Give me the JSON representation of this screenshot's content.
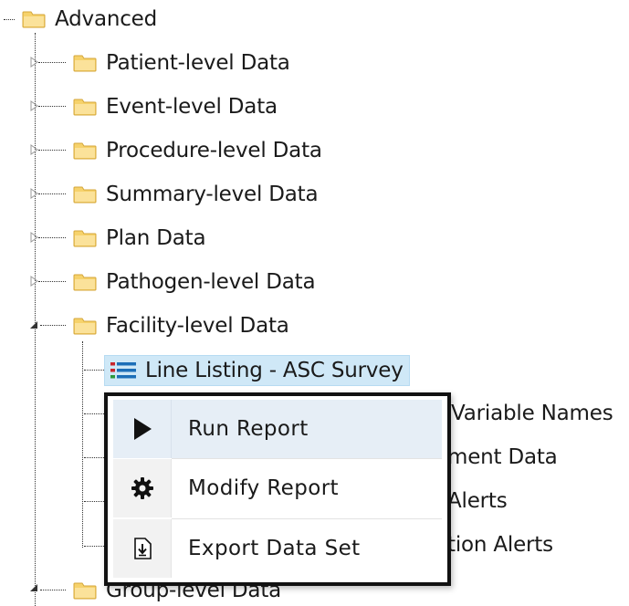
{
  "tree": {
    "root": {
      "label": "Advanced"
    },
    "children": [
      {
        "label": "Patient-level Data",
        "expanded": false
      },
      {
        "label": "Event-level Data",
        "expanded": false
      },
      {
        "label": "Procedure-level Data",
        "expanded": false
      },
      {
        "label": "Summary-level Data",
        "expanded": false
      },
      {
        "label": "Plan Data",
        "expanded": false
      },
      {
        "label": "Pathogen-level Data",
        "expanded": false
      },
      {
        "label": "Facility-level Data",
        "expanded": true
      },
      {
        "label": "Group-level Data",
        "expanded": true
      }
    ],
    "facility_children": [
      {
        "label": "Line Listing - ASC Survey",
        "selected": true
      },
      {
        "label": "Variable Names"
      },
      {
        "label": "ment Data"
      },
      {
        "label": "Alerts"
      },
      {
        "label": "tion Alerts"
      }
    ]
  },
  "context_menu": {
    "items": [
      {
        "label": "Run Report",
        "icon": "play-icon"
      },
      {
        "label": "Modify Report",
        "icon": "gear-icon"
      },
      {
        "label": "Export Data Set",
        "icon": "export-icon"
      }
    ]
  },
  "colors": {
    "folder_fill": "#f6d26b",
    "folder_edge": "#d4a63a",
    "selected_bg": "#cfe8f7",
    "menu_border": "#111111"
  }
}
